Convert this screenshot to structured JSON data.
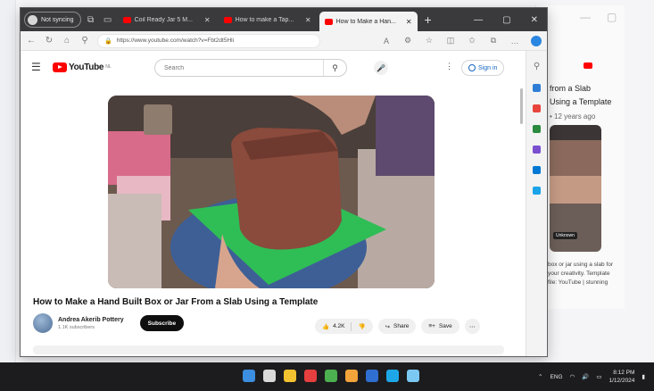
{
  "browser": {
    "profile_label": "Not syncing",
    "tabs": [
      {
        "title": "Coil Ready Jar 5 M...",
        "active": false
      },
      {
        "title": "How to make a Tap...",
        "active": false
      },
      {
        "title": "How to Make a Han...",
        "active": true
      }
    ],
    "new_tab_symbol": "+",
    "window_controls": {
      "minimize": "—",
      "maximize": "▢",
      "close": "✕"
    },
    "url": "https://www.youtube.com/watch?v=Fbt2dt5Hli",
    "sidebar_icon_colors": [
      "#2e7cd6",
      "#e8453c",
      "#2b8a3e",
      "#7a4fd0",
      "#0078d4",
      "#1aa3e8"
    ]
  },
  "youtube": {
    "logo_text": "YouTube",
    "logo_sup": "NL",
    "search_placeholder": "Search",
    "signin_label": "Sign in",
    "video": {
      "title": "How to Make a Hand Built Box or Jar From a Slab Using a Template",
      "channel_name": "Andrea Akerib Pottery",
      "subscribers": "1.1K subscribers",
      "subscribe_label": "Subscribe",
      "likes": "4.2K",
      "share_label": "Share",
      "save_label": "Save"
    }
  },
  "background_window": {
    "title": "from a Slab Using a Template",
    "meta": "• 12 years ago",
    "thumb_tag": "Unknown",
    "description": "box or jar using a slab for your creativity. Template file: YouTube | stunning"
  },
  "taskbar": {
    "app_colors": [
      "#3b8ee0",
      "#d9d9d9",
      "#f2c230",
      "#e63f3f",
      "#4caf50",
      "#f2a43a",
      "#2f6fd1",
      "#1ea7e8",
      "#7bc9f2"
    ],
    "tray_lang": "ENG",
    "time": "8:12 PM",
    "date": "1/12/2024"
  }
}
